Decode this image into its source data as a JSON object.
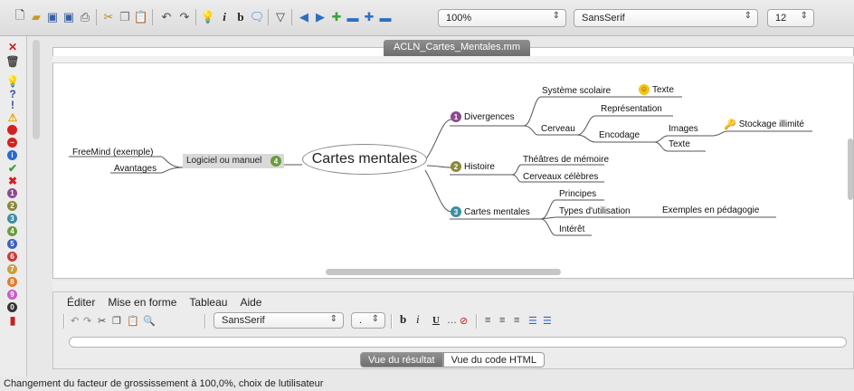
{
  "toolbar": {
    "zoom": "100%",
    "font": "SansSerif",
    "size": "12"
  },
  "map": {
    "tab_title": "ACLN_Cartes_Mentales.mm",
    "root": "Cartes mentales",
    "left_branch": "Logiciel ou manuel",
    "left_children": [
      "FreeMind (exemple)",
      "Avantages"
    ],
    "divergences": "Divergences",
    "systeme_scolaire": "Système scolaire",
    "texte1": "Texte",
    "cerveau": "Cerveau",
    "representation": "Représentation",
    "encodage": "Encodage",
    "images": "Images",
    "stockage": "Stockage illimité",
    "texte2": "Texte",
    "histoire": "Histoire",
    "theatres": "Théâtres de mémoire",
    "cerveaux": "Cerveaux célèbres",
    "cartes_mentales": "Cartes mentales",
    "principes": "Principes",
    "types": "Types d'utilisation",
    "exemples": "Exemples en pédagogie",
    "interet": "Intérêt",
    "numbers": [
      "1",
      "2",
      "3",
      "4"
    ]
  },
  "editor": {
    "menu": [
      "Éditer",
      "Mise en forme",
      "Tableau",
      "Aide"
    ],
    "font": "SansSerif",
    "size": ".",
    "tab_result": "Vue du résultat",
    "tab_html": "Vue du code HTML"
  },
  "status": "Changement du facteur de grossissement à 100,0%, choix de lutilisateur",
  "colors": {
    "purple": "#8e4a8e",
    "olive": "#8a8a3a",
    "teal": "#3c8ea0",
    "green": "#6a9c3c"
  }
}
